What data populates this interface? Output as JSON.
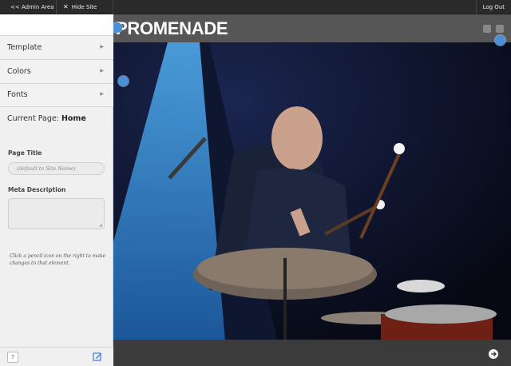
{
  "topbar": {
    "admin_label": "<< Admin Area",
    "hide_label": "Hide Site Builder",
    "logout_label": "Log Out"
  },
  "sidebar": {
    "menu": [
      {
        "label": "Template"
      },
      {
        "label": "Colors"
      },
      {
        "label": "Fonts"
      }
    ],
    "current_page_prefix": "Current Page:",
    "current_page_name": "Home",
    "page_title_label": "Page Title",
    "page_title_placeholder": "(default to Site Name)",
    "meta_description_label": "Meta Description",
    "hint": "Click a pencil icon on the right to make changes to that element.",
    "help_label": "?"
  },
  "site": {
    "logo": "PROMENADE",
    "accent_color": "#4a90d9",
    "icons": [
      "menu-icon",
      "search-icon",
      "pencil-icon",
      "arrow-right-icon"
    ]
  }
}
